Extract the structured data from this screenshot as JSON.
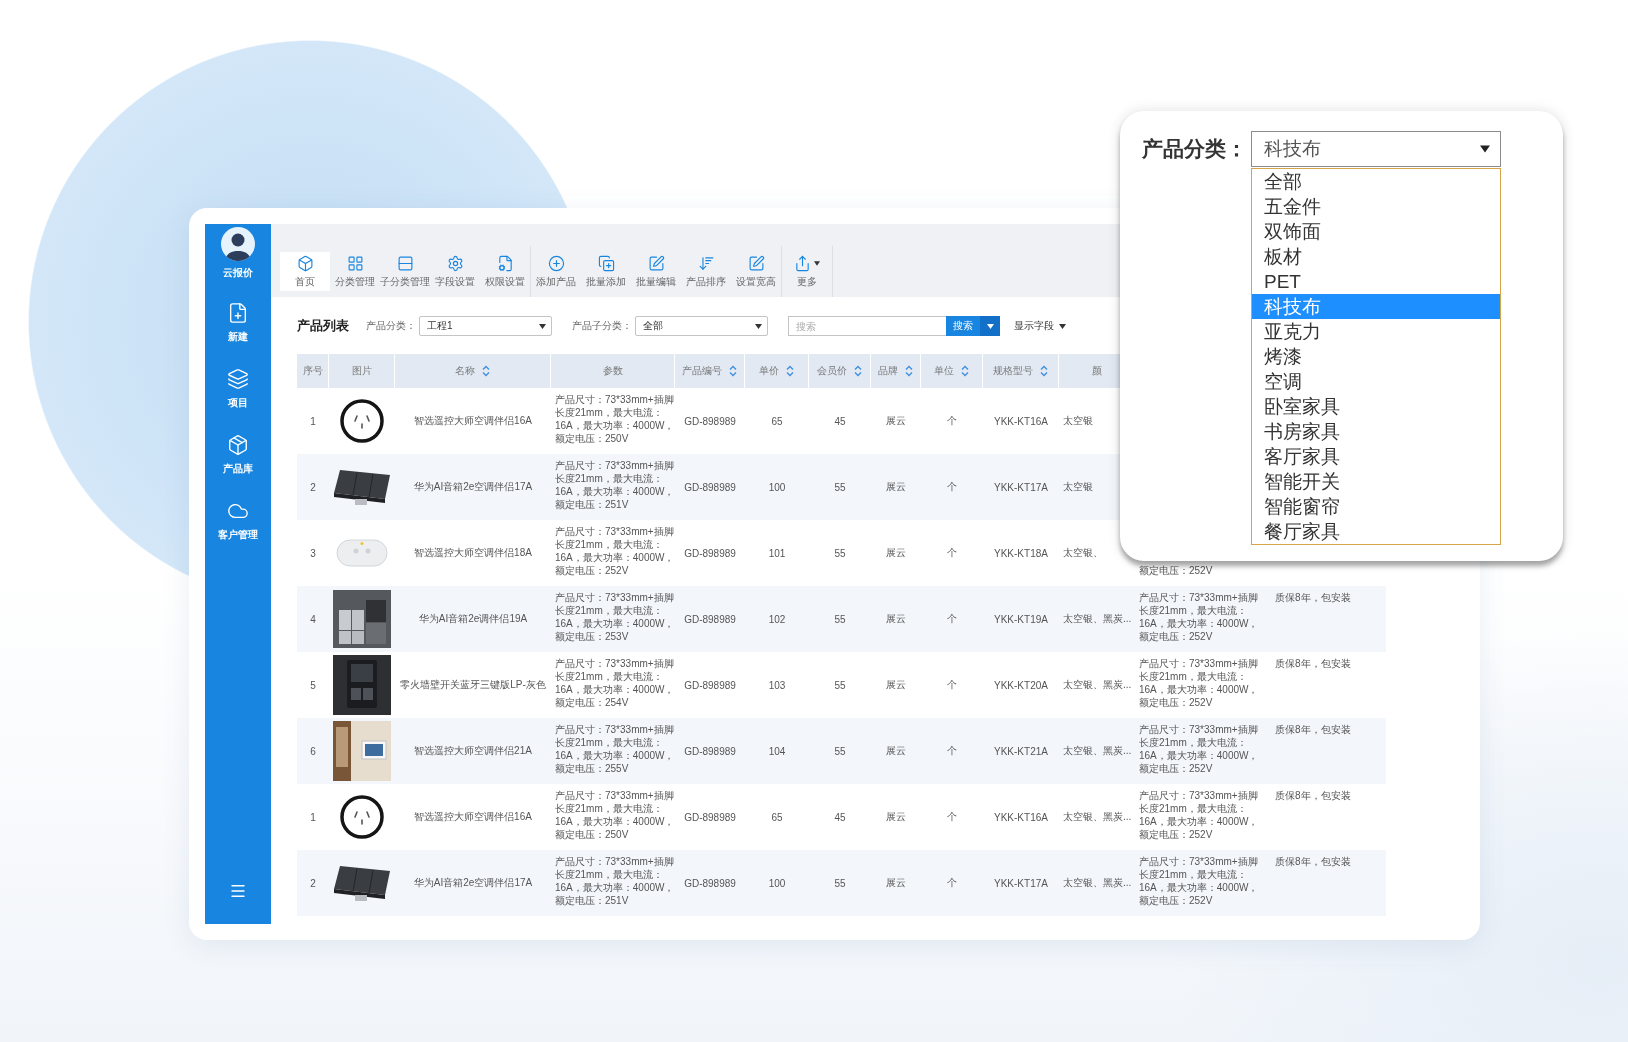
{
  "sidebar": {
    "brand": "云报价",
    "items": [
      {
        "label": "新建"
      },
      {
        "label": "项目"
      },
      {
        "label": "产品库"
      },
      {
        "label": "客户管理"
      }
    ]
  },
  "toolbar": {
    "groups": [
      {
        "items": [
          {
            "label": "首页",
            "selected": true,
            "has_menu": false
          },
          {
            "label": "分类管理",
            "selected": false,
            "has_menu": false
          },
          {
            "label": "子分类管理",
            "selected": false,
            "has_menu": false
          },
          {
            "label": "字段设置",
            "selected": false,
            "has_menu": false
          },
          {
            "label": "权限设置",
            "selected": false,
            "has_menu": false
          }
        ]
      },
      {
        "items": [
          {
            "label": "添加产品",
            "selected": false,
            "has_menu": false
          },
          {
            "label": "批量添加",
            "selected": false,
            "has_menu": false
          },
          {
            "label": "批量编辑",
            "selected": false,
            "has_menu": false
          },
          {
            "label": "产品排序",
            "selected": false,
            "has_menu": false
          },
          {
            "label": "设置宽高",
            "selected": false,
            "has_menu": false
          }
        ]
      },
      {
        "items": [
          {
            "label": "更多",
            "selected": false,
            "has_menu": true
          }
        ]
      }
    ]
  },
  "filters": {
    "title": "产品列表",
    "category": {
      "label": "产品分类：",
      "value": "工程1"
    },
    "subcategory": {
      "label": "产品子分类：",
      "value": "全部"
    },
    "search": {
      "placeholder": "搜索",
      "button": "搜索"
    },
    "fields_button": "显示字段"
  },
  "table": {
    "columns": [
      {
        "label": "序号",
        "sortable": false
      },
      {
        "label": "图片",
        "sortable": false
      },
      {
        "label": "名称",
        "sortable": true
      },
      {
        "label": "参数",
        "sortable": false
      },
      {
        "label": "产品编号",
        "sortable": true
      },
      {
        "label": "单价",
        "sortable": true
      },
      {
        "label": "会员价",
        "sortable": true
      },
      {
        "label": "品牌",
        "sortable": true
      },
      {
        "label": "单位",
        "sortable": true
      },
      {
        "label": "规格型号",
        "sortable": true
      },
      {
        "label": "颜",
        "sortable": false
      }
    ],
    "rows": [
      {
        "index": "1",
        "photo": {
          "kind": "socket"
        },
        "name": "智选遥控大师空调伴侣16A",
        "params": [
          "产品尺寸：73*33mm+插脚",
          "长度21mm，最大电流：",
          "16A，最大功率：4000W，",
          "额定电压：250V"
        ],
        "code": "GD-898989",
        "price": "65",
        "member_price": "45",
        "brand": "展云",
        "unit": "个",
        "model": "YKK-KT16A",
        "finish": "太空银"
      },
      {
        "index": "2",
        "photo": {
          "kind": "switch"
        },
        "name": "华为AI音箱2e空调伴侣17A",
        "params": [
          "产品尺寸：73*33mm+插脚",
          "长度21mm，最大电流：",
          "16A，最大功率：4000W，",
          "额定电压：251V"
        ],
        "code": "GD-898989",
        "price": "100",
        "member_price": "55",
        "brand": "展云",
        "unit": "个",
        "model": "YKK-KT17A",
        "finish": "太空银"
      },
      {
        "index": "3",
        "photo": {
          "kind": "speaker"
        },
        "name": "智选遥控大师空调伴侣18A",
        "params": [
          "产品尺寸：73*33mm+插脚",
          "长度21mm，最大电流：",
          "16A，最大功率：4000W，",
          "额定电压：252V"
        ],
        "code": "GD-898989",
        "price": "101",
        "member_price": "55",
        "brand": "展云",
        "unit": "个",
        "model": "YKK-KT18A",
        "finish": "太空银、",
        "column_12": [
          "额定电压：252V"
        ]
      },
      {
        "index": "4",
        "photo": {
          "kind": "panel_gray"
        },
        "name": "华为AI音箱2e调伴侣19A",
        "params": [
          "产品尺寸：73*33mm+插脚",
          "长度21mm，最大电流：",
          "16A，最大功率：4000W，",
          "额定电压：253V"
        ],
        "code": "GD-898989",
        "price": "102",
        "member_price": "55",
        "brand": "展云",
        "unit": "个",
        "model": "YKK-KT19A",
        "finish": "太空银、黑炭...",
        "column_12": [
          "产品尺寸：73*33mm+插脚",
          "长度21mm，最大电流：",
          "16A，最大功率：4000W，",
          "额定电压：252V"
        ],
        "column_13": "质保8年，包安装"
      },
      {
        "index": "5",
        "photo": {
          "kind": "panel_dark"
        },
        "name": "零火墙壁开关蓝牙三键版LP-灰色",
        "params": [
          "产品尺寸：73*33mm+插脚",
          "长度21mm，最大电流：",
          "16A，最大功率：4000W，",
          "额定电压：254V"
        ],
        "code": "GD-898989",
        "price": "103",
        "member_price": "55",
        "brand": "展云",
        "unit": "个",
        "model": "YKK-KT20A",
        "finish": "太空银、黑炭...",
        "column_12": [
          "产品尺寸：73*33mm+插脚",
          "长度21mm，最大电流：",
          "16A，最大功率：4000W，",
          "额定电压：252V"
        ],
        "column_13": "质保8年，包安装"
      },
      {
        "index": "6",
        "photo": {
          "kind": "room"
        },
        "name": "智选遥控大师空调伴侣21A",
        "params": [
          "产品尺寸：73*33mm+插脚",
          "长度21mm，最大电流：",
          "16A，最大功率：4000W，",
          "额定电压：255V"
        ],
        "code": "GD-898989",
        "price": "104",
        "member_price": "55",
        "brand": "展云",
        "unit": "个",
        "model": "YKK-KT21A",
        "finish": "太空银、黑炭...",
        "column_12": [
          "产品尺寸：73*33mm+插脚",
          "长度21mm，最大电流：",
          "16A，最大功率：4000W，",
          "额定电压：252V"
        ],
        "column_13": "质保8年，包安装"
      },
      {
        "index": "1",
        "photo": {
          "kind": "socket"
        },
        "name": "智选遥控大师空调伴侣16A",
        "params": [
          "产品尺寸：73*33mm+插脚",
          "长度21mm，最大电流：",
          "16A，最大功率：4000W，",
          "额定电压：250V"
        ],
        "code": "GD-898989",
        "price": "65",
        "member_price": "45",
        "brand": "展云",
        "unit": "个",
        "model": "YKK-KT16A",
        "finish": "太空银、黑炭...",
        "column_12": [
          "产品尺寸：73*33mm+插脚",
          "长度21mm，最大电流：",
          "16A，最大功率：4000W，",
          "额定电压：252V"
        ],
        "column_13": "质保8年，包安装"
      },
      {
        "index": "2",
        "photo": {
          "kind": "switch"
        },
        "name": "华为AI音箱2e空调伴侣17A",
        "params": [
          "产品尺寸：73*33mm+插脚",
          "长度21mm，最大电流：",
          "16A，最大功率：4000W，",
          "额定电压：251V"
        ],
        "code": "GD-898989",
        "price": "100",
        "member_price": "55",
        "brand": "展云",
        "unit": "个",
        "model": "YKK-KT17A",
        "finish": "太空银、黑炭...",
        "column_12": [
          "产品尺寸：73*33mm+插脚",
          "长度21mm，最大电流：",
          "16A，最大功率：4000W，",
          "额定电压：252V"
        ],
        "column_13": "质保8年，包安装"
      }
    ]
  },
  "popup": {
    "label": "产品分类：",
    "value": "科技布",
    "options": [
      {
        "label": "全部",
        "selected": false
      },
      {
        "label": "五金件",
        "selected": false
      },
      {
        "label": "双饰面",
        "selected": false
      },
      {
        "label": "板材",
        "selected": false
      },
      {
        "label": "PET",
        "selected": false
      },
      {
        "label": "科技布",
        "selected": true
      },
      {
        "label": "亚克力",
        "selected": false
      },
      {
        "label": "烤漆",
        "selected": false
      },
      {
        "label": "空调",
        "selected": false
      },
      {
        "label": "卧室家具",
        "selected": false
      },
      {
        "label": "书房家具",
        "selected": false
      },
      {
        "label": "客厅家具",
        "selected": false
      },
      {
        "label": "智能开关",
        "selected": false
      },
      {
        "label": "智能窗帘",
        "selected": false
      },
      {
        "label": "餐厅家具",
        "selected": false
      }
    ]
  }
}
